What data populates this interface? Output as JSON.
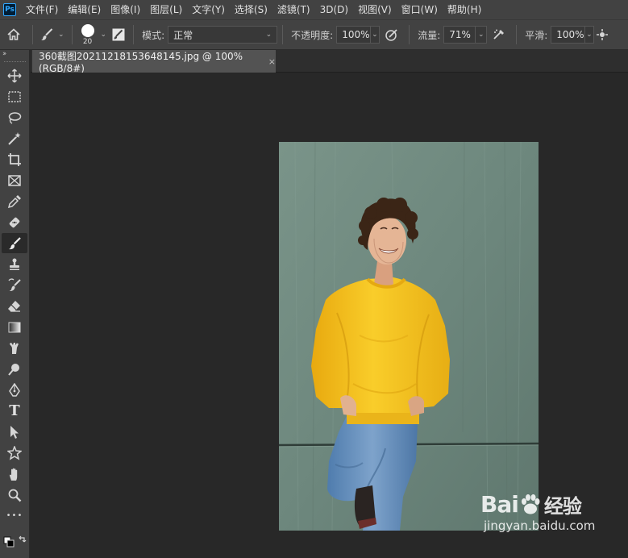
{
  "app": {
    "logo": "Ps"
  },
  "menu": [
    "文件(F)",
    "编辑(E)",
    "图像(I)",
    "图层(L)",
    "文字(Y)",
    "选择(S)",
    "滤镜(T)",
    "3D(D)",
    "视图(V)",
    "窗口(W)",
    "帮助(H)"
  ],
  "options": {
    "brush_size": "20",
    "mode_label": "模式:",
    "mode_value": "正常",
    "opacity_label": "不透明度:",
    "opacity_value": "100%",
    "flow_label": "流量:",
    "flow_value": "71%",
    "smoothing_label": "平滑:",
    "smoothing_value": "100%"
  },
  "document": {
    "tab_title": "360截图20211218153648145.jpg @ 100%(RGB/8#)",
    "close": "×"
  },
  "toolbar": {
    "collapse": "››",
    "tools": [
      "move",
      "marquee",
      "lasso",
      "magic-wand",
      "crop",
      "frame",
      "eyedropper",
      "healing",
      "brush",
      "stamp",
      "history-brush",
      "eraser",
      "gradient",
      "smudge",
      "dodge",
      "pen",
      "type",
      "path-select",
      "shape",
      "hand",
      "zoom",
      "more"
    ],
    "active_tool": "brush",
    "type_glyph": "T",
    "more_glyph": "•••"
  },
  "watermark": {
    "logo": "Bai",
    "logo_suffix": "经验",
    "url": "jingyan.baidu.com"
  },
  "colors": {
    "accent": "#31a8ff",
    "sweater": "#f5c41b",
    "wall": "#6f8a80",
    "jeans": "#5a87b8"
  }
}
